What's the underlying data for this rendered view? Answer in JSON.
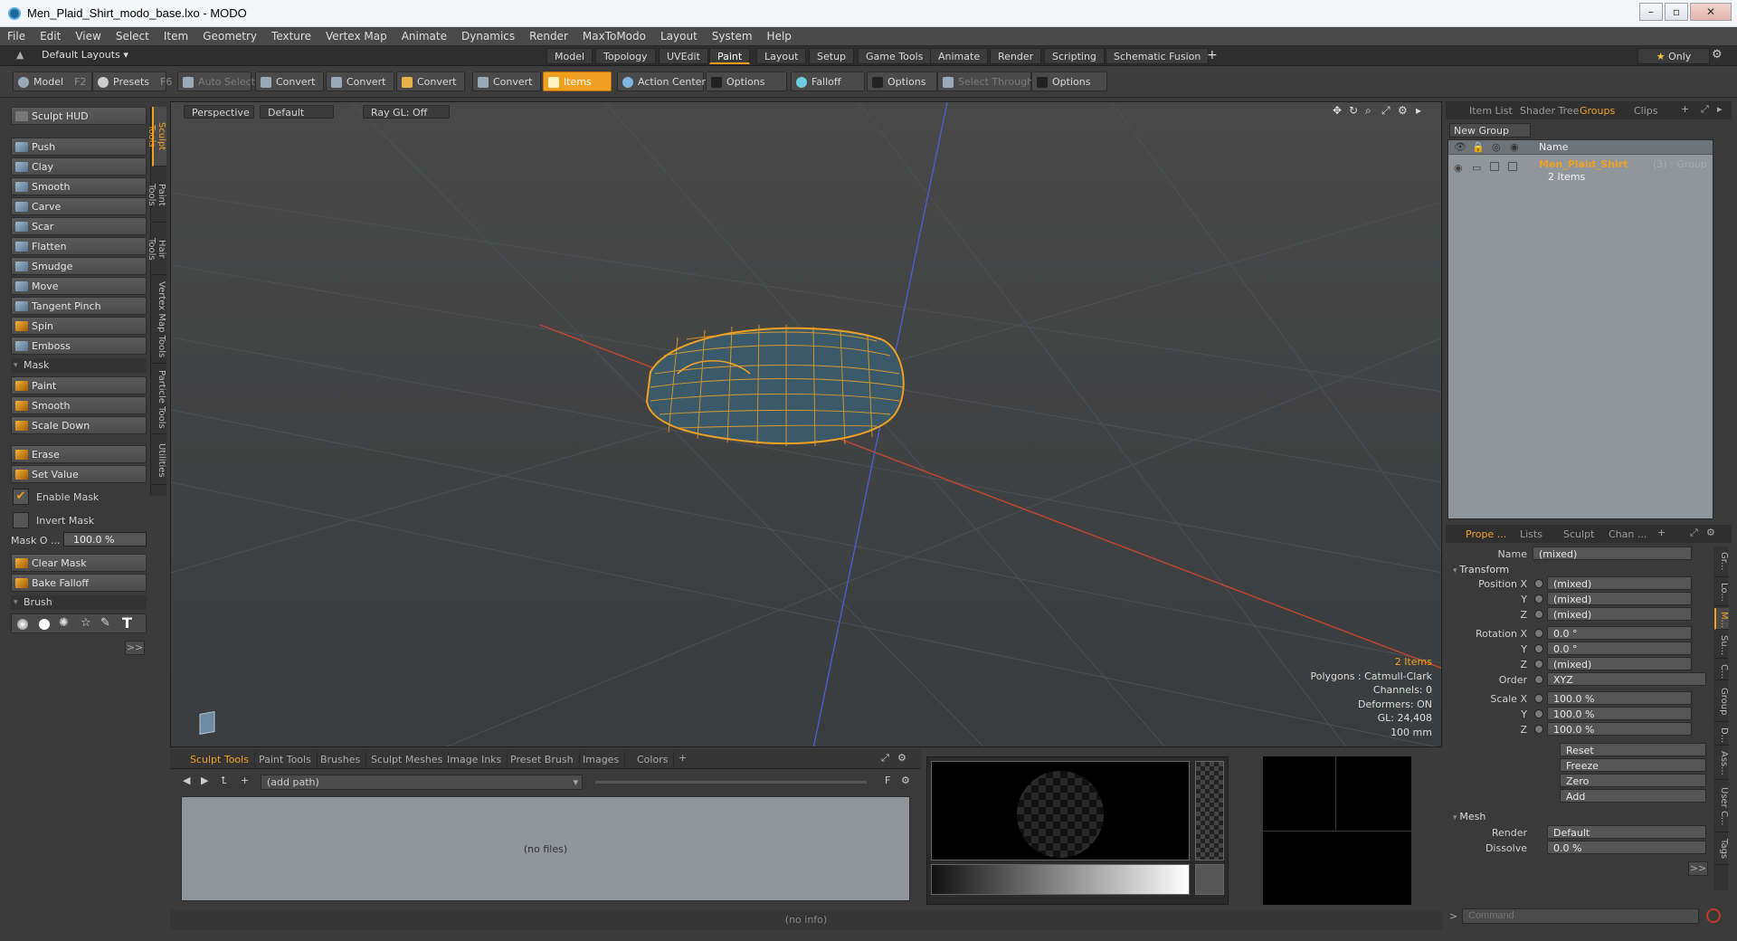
{
  "window": {
    "title": "Men_Plaid_Shirt_modo_base.lxo - MODO"
  },
  "menubar": [
    "File",
    "Edit",
    "View",
    "Select",
    "Item",
    "Geometry",
    "Texture",
    "Vertex Map",
    "Animate",
    "Dynamics",
    "Render",
    "MaxToModo",
    "Layout",
    "System",
    "Help"
  ],
  "layoutbar": {
    "layouts_label": "Default Layouts",
    "tabs": [
      "Model",
      "Topology",
      "UVEdit",
      "Paint",
      "Layout",
      "Setup",
      "Game Tools",
      "Animate",
      "Render",
      "Scripting",
      "Schematic Fusion"
    ],
    "active_tab": "Paint",
    "only_label": "Only"
  },
  "toolbar": {
    "model": "Model",
    "model_key": "F2",
    "presets": "Presets",
    "presets_key": "F6",
    "auto_select": "Auto Select",
    "convert": "Convert",
    "items": "Items",
    "action_center": "Action Center",
    "options": "Options",
    "falloff": "Falloff",
    "select_through": "Select Through"
  },
  "sculpt": {
    "hud": "Sculpt HUD",
    "tools": [
      "Push",
      "Clay",
      "Smooth",
      "Carve",
      "Scar",
      "Flatten",
      "Smudge",
      "Move",
      "Tangent Pinch",
      "Spin",
      "Emboss"
    ],
    "mask_header": "Mask",
    "mask_tools": [
      "Paint",
      "Smooth",
      "Scale Down"
    ],
    "erase": "Erase",
    "set_value": "Set Value",
    "enable_mask": "Enable Mask",
    "invert_mask": "Invert Mask",
    "mask_opacity_label": "Mask O ...",
    "mask_opacity_value": "100.0 %",
    "clear_mask": "Clear Mask",
    "bake_falloff": "Bake Falloff",
    "brush_header": "Brush",
    "more": ">>"
  },
  "sidetabs": [
    "Sculpt Tools",
    "Paint Tools",
    "Hair Tools",
    "Vertex Map Tools",
    "Particle Tools",
    "Utilities"
  ],
  "viewport": {
    "view": "Perspective",
    "shading": "Default",
    "raygl": "Ray GL: Off",
    "info": {
      "items": "2 Items",
      "polygons": "Polygons : Catmull-Clark",
      "channels": "Channels: 0",
      "deformers": "Deformers: ON",
      "gl": "GL: 24,408",
      "scale": "100 mm"
    }
  },
  "bottom": {
    "tabs": [
      "Sculpt Tools",
      "Paint Tools",
      "Brushes",
      "Sculpt Meshes",
      "Image Inks",
      "Preset Brush",
      "Images",
      "Colors"
    ],
    "path": "(add path)",
    "no_files": "(no files)",
    "status": "(no info)"
  },
  "right_top": {
    "tabs": [
      "Item List",
      "Shader Tree",
      "Groups",
      "Clips"
    ],
    "new_group": "New Group",
    "col_name": "Name",
    "group_name": "Men_Plaid_Shirt",
    "group_suffix": "(3) : Group",
    "group_count": "2 Items"
  },
  "properties": {
    "tabs": [
      "Prope ...",
      "Lists",
      "Sculpt",
      "Chan ..."
    ],
    "name_label": "Name",
    "name_value": "(mixed)",
    "transform": "Transform",
    "position_x": "Position X",
    "y": "Y",
    "z": "Z",
    "mixed": "(mixed)",
    "rotation_x": "Rotation X",
    "rot_value": "0.0 °",
    "order_label": "Order",
    "order_value": "XYZ",
    "scale_x": "Scale X",
    "scale_value": "100.0 %",
    "reset": "Reset",
    "freeze": "Freeze",
    "zero": "Zero",
    "add": "Add",
    "mesh": "Mesh",
    "render_label": "Render",
    "render_value": "Default",
    "dissolve_label": "Dissolve",
    "dissolve_value": "0.0 %",
    "more": ">>",
    "side_tabs": [
      "Gr...",
      "Lo...",
      "M...",
      "Su...",
      "C...",
      "Group",
      "D...",
      "Ass...",
      "User C...",
      "Tags"
    ]
  },
  "command": {
    "placeholder": "Command"
  }
}
